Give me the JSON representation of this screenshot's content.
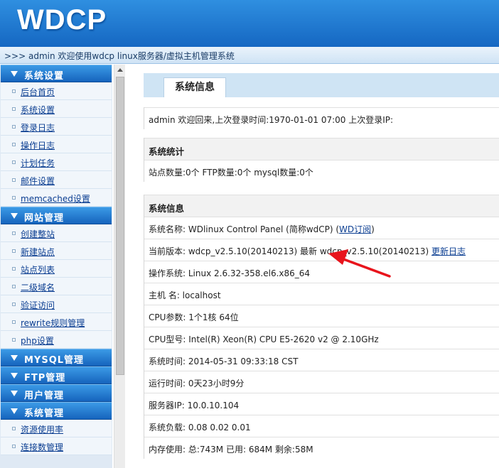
{
  "header": {
    "logo": "WDCP",
    "welcome": ">>> admin 欢迎使用wdcp linux服务器/虚拟主机管理系统"
  },
  "sidebar": {
    "sections": [
      {
        "title": "系统设置",
        "items": [
          "后台首页",
          "系统设置",
          "登录日志",
          "操作日志",
          "计划任务",
          "邮件设置",
          "memcached设置"
        ]
      },
      {
        "title": "网站管理",
        "items": [
          "创建整站",
          "新建站点",
          "站点列表",
          "二级域名",
          "验证访问",
          "rewrite规则管理",
          "php设置"
        ]
      },
      {
        "title": "MYSQL管理",
        "items": []
      },
      {
        "title": "FTP管理",
        "items": []
      },
      {
        "title": "用户管理",
        "items": []
      },
      {
        "title": "系统管理",
        "items": [
          "资源使用率",
          "连接数管理"
        ]
      }
    ]
  },
  "content": {
    "tab": "系统信息",
    "login_info": "admin 欢迎回来,上次登录时间:1970-01-01 07:00 上次登录IP:",
    "stats_title": "系统统计",
    "stats": "站点数量:0个  FTP数量:0个  mysql数量:0个",
    "sysinfo_title": "系统信息",
    "sys_name_prefix": "系统名称: WDlinux Control Panel (简称wdCP) (",
    "sys_name_link": "WD订阅",
    "sys_name_suffix": ")",
    "version_text": "当前版本: wdcp_v2.5.10(20140213) 最新 wdcp_v2.5.10(20140213) ",
    "version_link": "更新日志",
    "os": "操作系统: Linux 2.6.32-358.el6.x86_64",
    "hostname": "主机 名: localhost",
    "cpu_params": "CPU参数: 1个1核 64位",
    "cpu_model": "CPU型号:  Intel(R) Xeon(R) CPU E5-2620 v2 @ 2.10GHz",
    "sys_time": "系统时间: 2014-05-31 09:33:18 CST",
    "uptime": "运行时间: 0天23小时9分",
    "server_ip": "服务器IP: 10.0.10.104",
    "load": "系统负载:  0.08   0.02   0.01",
    "memory": "内存使用: 总:743M   已用: 684M   剩余:58M"
  },
  "colors": {
    "header": "#1567c2",
    "menu_header": "#2a84d8",
    "link": "#0a3d91",
    "arrow": "#e8141c"
  }
}
